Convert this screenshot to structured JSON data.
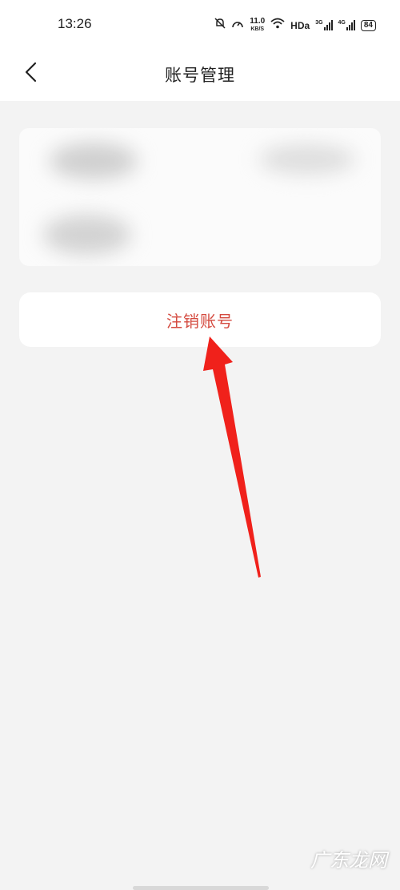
{
  "status_bar": {
    "time": "13:26",
    "net_speed_value": "11.0",
    "net_speed_unit": "KB/S",
    "hd": "HDa",
    "signal1": "3G",
    "signal2": "4G",
    "battery": "84"
  },
  "header": {
    "title": "账号管理"
  },
  "main": {
    "deregister_label": "注销账号"
  },
  "watermark": {
    "text": "广东龙网"
  },
  "colors": {
    "accent_red": "#d44a3f",
    "background": "#f3f3f3"
  }
}
